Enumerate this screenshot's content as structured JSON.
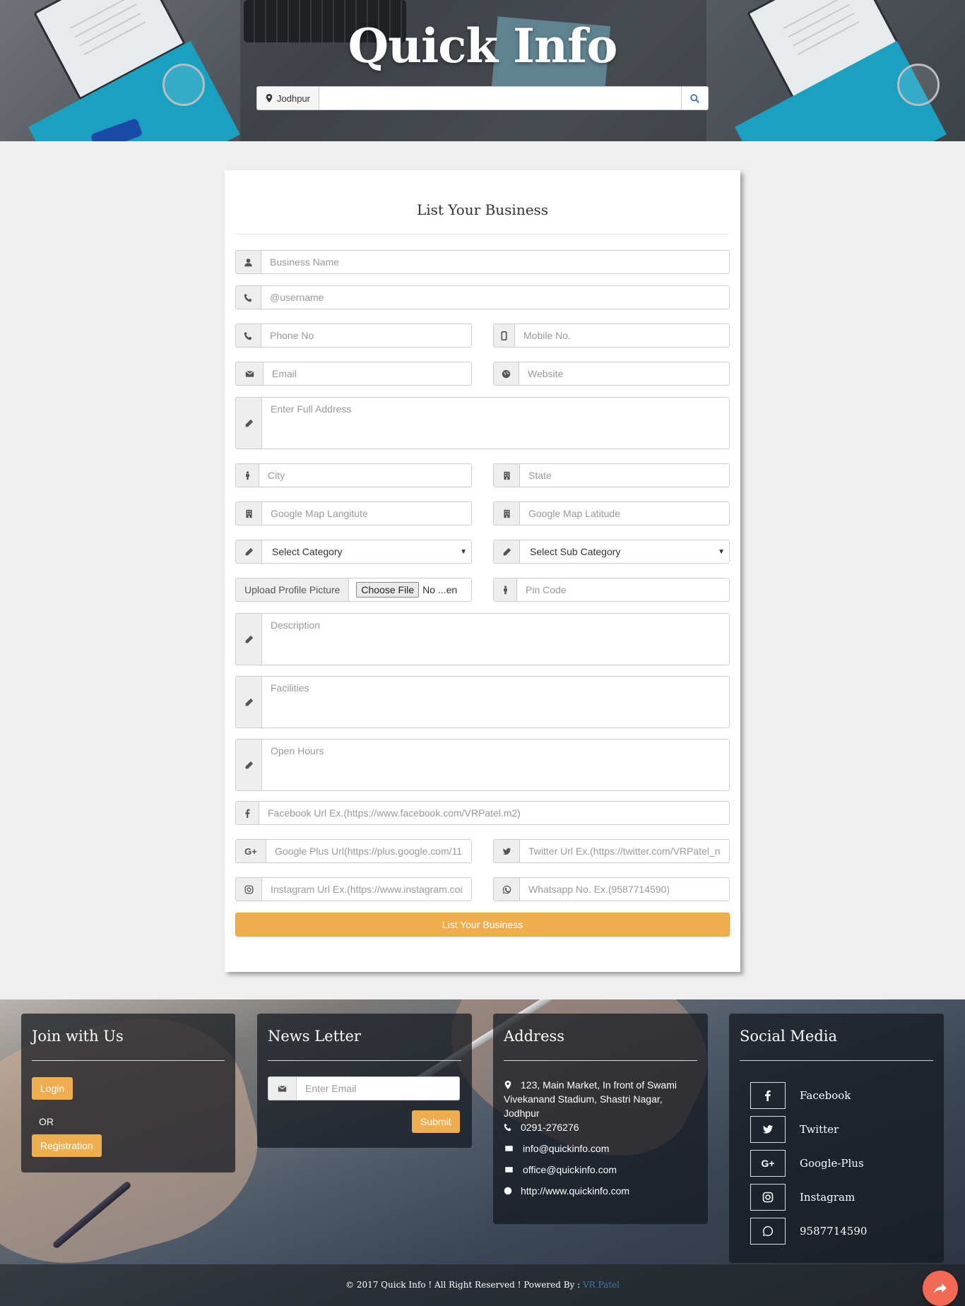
{
  "header": {
    "title": "Quick Info",
    "location": "Jodhpur",
    "search_placeholder": ""
  },
  "form": {
    "title": "List Your Business",
    "fields": {
      "business_name": "Business Name",
      "username": "@username",
      "phone": "Phone No",
      "mobile": "Mobile No.",
      "email": "Email",
      "website": "Website",
      "address": "Enter Full Address",
      "city": "City",
      "state": "State",
      "map_longitude": "Google Map Langitute",
      "map_latitude": "Google Map Latitude",
      "category": "Select Category",
      "sub_category": "Select Sub Category",
      "upload_label": "Upload Profile Picture",
      "choose_file": "Choose File",
      "file_status": "No ...en",
      "pin_code": "Pin Code",
      "description": "Description",
      "facilities": "Facilities",
      "open_hours": "Open Hours",
      "facebook": "Facebook Url Ex.(https://www.facebook.com/VRPatel.m2)",
      "google_plus": "Google Plus Url(https://plus.google.com/11",
      "twitter": "Twitter Url Ex.(https://twitter.com/VRPatel_n",
      "instagram": "Instagram Url Ex.(https://www.instagram.coi",
      "whatsapp": "Whatsapp No. Ex.(9587714590)"
    },
    "submit_label": "List Your Business"
  },
  "footer": {
    "join": {
      "title": "Join with Us",
      "login": "Login",
      "or": "OR",
      "registration": "Registration"
    },
    "newsletter": {
      "title": "News Letter",
      "email_placeholder": "Enter Email",
      "submit": "Submit"
    },
    "address": {
      "title": "Address",
      "street": "123, Main Market, In front of Swami Vivekanand Stadium, Shastri Nagar, Jodhpur",
      "phone": "0291-276276",
      "email1": "info@quickinfo.com",
      "email2": "office@quickinfo.com",
      "website": "http://www.quickinfo.com"
    },
    "social": {
      "title": "Social Media",
      "items": [
        "Facebook",
        "Twitter",
        "Google-Plus",
        "Instagram",
        "9587714590"
      ]
    },
    "copyright": "© 2017 Quick Info ! All Right Reserved ! Powered By :",
    "powered_by": "VR Patel"
  },
  "colors": {
    "accent": "#f0ad4e",
    "link": "#337ab7",
    "share": "#f26a55"
  }
}
